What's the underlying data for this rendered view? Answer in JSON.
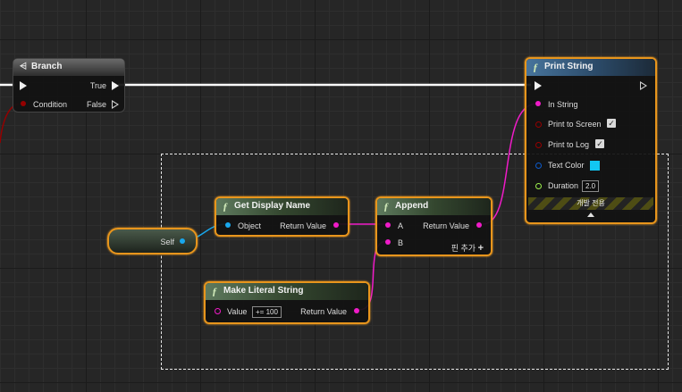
{
  "graph": {
    "nodes": {
      "branch": {
        "title": "Branch",
        "icon": "branch-icon",
        "pins": {
          "condition": "Condition",
          "true": "True",
          "false": "False"
        }
      },
      "print_string": {
        "title": "Print String",
        "icon": "function-icon",
        "pins": {
          "in_string": "In String",
          "print_to_screen": "Print to Screen",
          "print_to_log": "Print to Log",
          "text_color": "Text Color",
          "duration": "Duration"
        },
        "duration_value": "2.0",
        "print_to_screen_checked": true,
        "print_to_log_checked": true,
        "text_color_value": "#12c6f2",
        "dev_only_label": "개발 전용"
      },
      "get_display_name": {
        "title": "Get Display Name",
        "icon": "function-icon",
        "pins": {
          "object": "Object",
          "return_value": "Return Value"
        }
      },
      "append": {
        "title": "Append",
        "icon": "function-icon",
        "pins": {
          "a": "A",
          "b": "B",
          "return_value": "Return Value"
        },
        "add_pin_label": "핀 추가",
        "add_pin_icon": "plus-icon"
      },
      "make_literal_string": {
        "title": "Make Literal String",
        "icon": "function-icon",
        "pins": {
          "value": "Value",
          "return_value": "Return Value"
        },
        "value_text": "+= 100"
      },
      "self": {
        "label": "Self"
      }
    },
    "colors": {
      "exec": "#ffffff",
      "string": "#f01bc8",
      "object": "#19a7ec",
      "bool": "#950000",
      "struct": "#0d5bcc",
      "float": "#9cf04d",
      "selected_border": "#e8951c"
    }
  }
}
